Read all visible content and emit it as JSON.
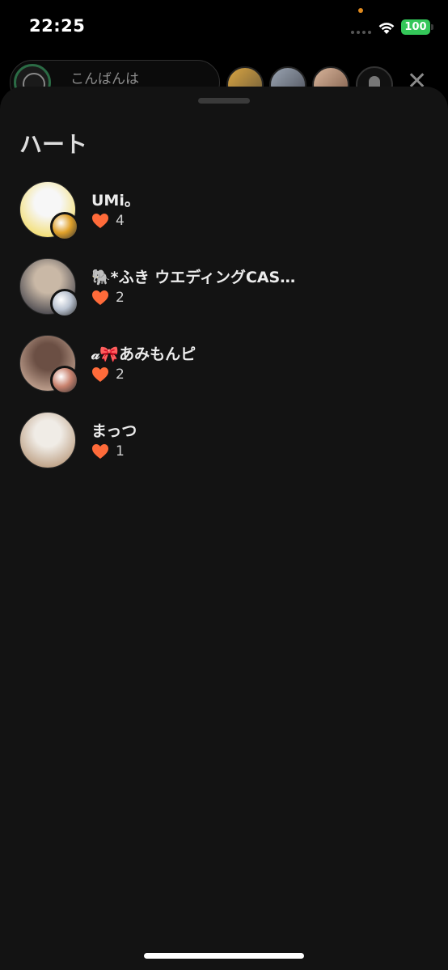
{
  "status_bar": {
    "time": "22:25",
    "battery": "100"
  },
  "live_header": {
    "host_greeting": "こんばんは",
    "close_glyph": "✕"
  },
  "sheet": {
    "title": "ハート"
  },
  "users": [
    {
      "name": "UMi。",
      "hearts": "4",
      "avatar_colors": [
        "#f7f7f7",
        "#f2d43b"
      ],
      "badge_color": "#e0a12a"
    },
    {
      "name": "🐘*ふき ウエディングCAS…",
      "hearts": "2",
      "avatar_colors": [
        "#c9b8a6",
        "#1b1f2e"
      ],
      "badge_color": "#b9c2d0"
    },
    {
      "name": "𝒶🎀あみもんピ",
      "hearts": "2",
      "avatar_colors": [
        "#6b4f44",
        "#e3c3ae"
      ],
      "badge_color": "#c9826e"
    },
    {
      "name": "まっつ",
      "hearts": "1",
      "avatar_colors": [
        "#f0ece6",
        "#a9825e"
      ],
      "badge_color": null
    }
  ],
  "icons": {
    "heart": "heart-icon",
    "close": "close-icon",
    "wifi": "wifi-icon",
    "person": "person-icon"
  },
  "colors": {
    "heart": "#ff6b3a",
    "battery": "#34c759",
    "sheet_bg": "#131313"
  }
}
